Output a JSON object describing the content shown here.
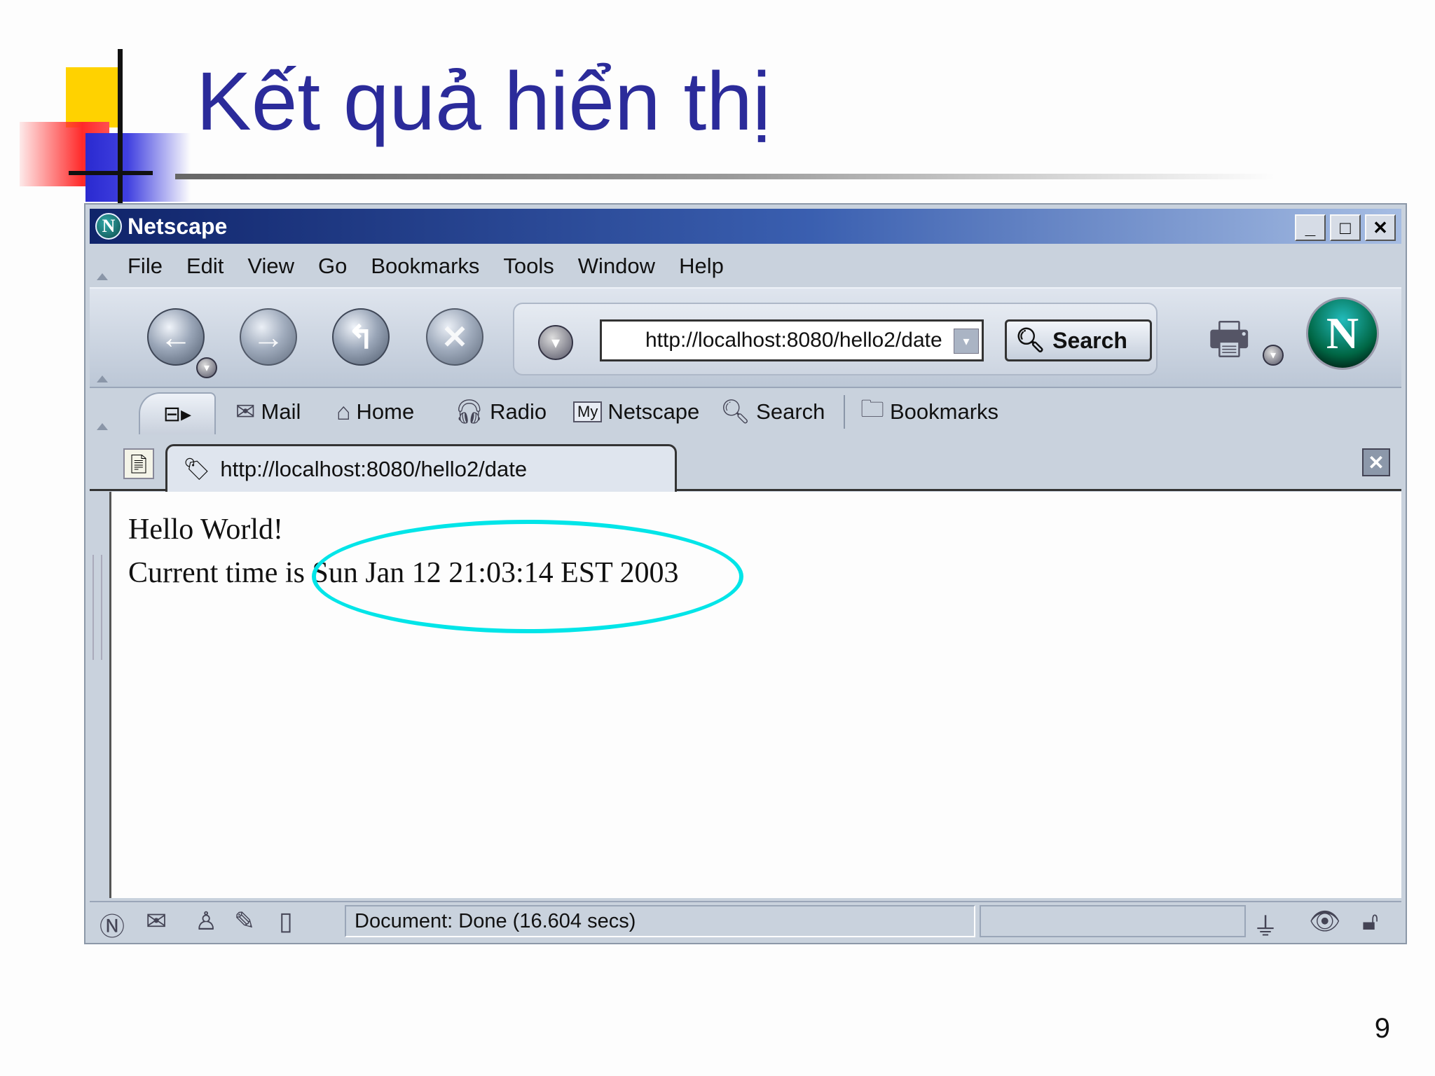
{
  "slide": {
    "title": "Kết quả hiển thị",
    "page_number": "9"
  },
  "browser": {
    "window_title": "Netscape",
    "window_buttons": {
      "minimize": "_",
      "maximize": "□",
      "close": "✕"
    },
    "menu": [
      {
        "label": "File"
      },
      {
        "label": "Edit"
      },
      {
        "label": "View"
      },
      {
        "label": "Go"
      },
      {
        "label": "Bookmarks"
      },
      {
        "label": "Tools"
      },
      {
        "label": "Window"
      },
      {
        "label": "Help"
      }
    ],
    "url": "http://localhost:8080/hello2/date",
    "search_button": "Search",
    "personal_toolbar": {
      "mail": "Mail",
      "home": "Home",
      "radio": "Radio",
      "my_netscape_badge": "My",
      "netscape": "Netscape",
      "search": "Search",
      "bookmarks": "Bookmarks"
    },
    "tab": {
      "label": "http://localhost:8080/hello2/date"
    },
    "content": {
      "line1": "Hello World!",
      "line2": "Current time is Sun Jan 12 21:03:14 EST 2003"
    },
    "status": "Document: Done (16.604 secs)"
  },
  "colors": {
    "title": "#2b2b9a",
    "highlight": "#00e5e8",
    "titlebar_start": "#10246a"
  },
  "icons": {
    "back": "back-arrow-icon",
    "forward": "forward-arrow-icon",
    "reload": "reload-icon",
    "stop": "stop-icon",
    "netscape_logo": "netscape-logo-icon",
    "mail": "envelope-icon",
    "home": "house-icon",
    "radio": "headphones-icon",
    "search": "magnifier-icon",
    "bookmarks": "folder-icon",
    "close_tab": "close-icon"
  }
}
